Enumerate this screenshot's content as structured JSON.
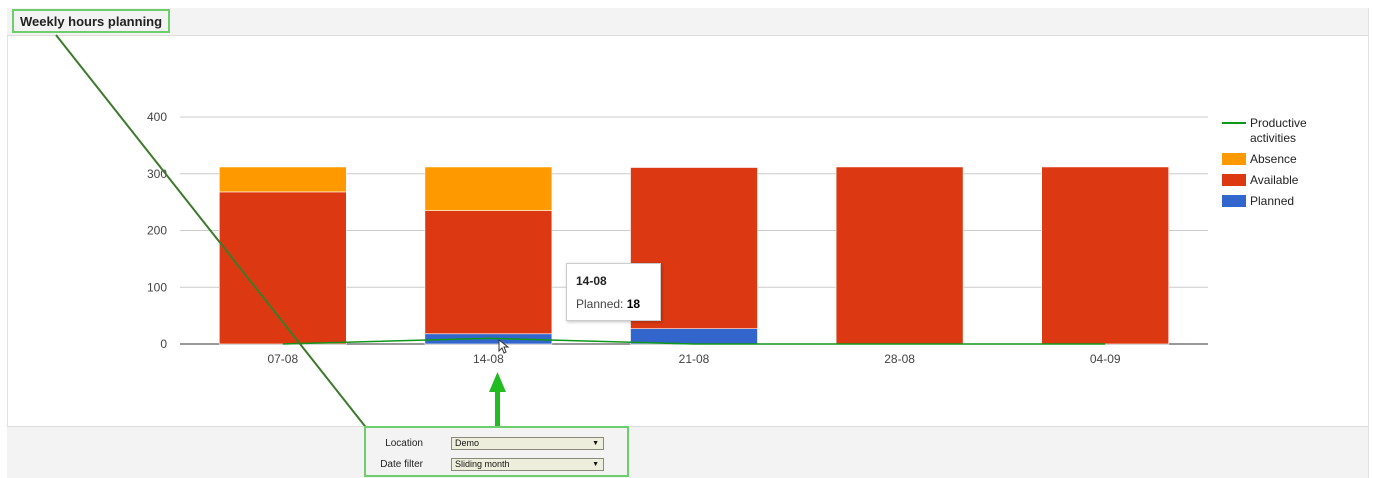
{
  "panel": {
    "title": "Weekly hours planning"
  },
  "chart_data": {
    "type": "bar",
    "stacked": true,
    "categories": [
      "07-08",
      "14-08",
      "21-08",
      "28-08",
      "04-09"
    ],
    "series": [
      {
        "name": "Planned",
        "kind": "bar",
        "color": "#3366cc",
        "values": [
          0,
          18,
          27,
          0,
          0
        ]
      },
      {
        "name": "Available",
        "kind": "bar",
        "color": "#dc3912",
        "values": [
          268,
          217,
          284,
          312,
          312
        ]
      },
      {
        "name": "Absence",
        "kind": "bar",
        "color": "#ff9900",
        "values": [
          44,
          77,
          0,
          0,
          0
        ]
      },
      {
        "name": "Productive activities",
        "kind": "line",
        "color": "#109618",
        "values": [
          0,
          10,
          0,
          0,
          0
        ]
      }
    ],
    "yticks": [
      0,
      100,
      200,
      300,
      400
    ],
    "ylim": [
      0,
      400
    ],
    "grid": true,
    "legend_position": "right"
  },
  "legend": {
    "items": [
      {
        "label": "Productive\nactivities",
        "line1": "Productive",
        "line2": "activities",
        "color": "#109618",
        "shape": "line"
      },
      {
        "label": "Absence",
        "color": "#ff9900",
        "shape": "box"
      },
      {
        "label": "Available",
        "color": "#dc3912",
        "shape": "box"
      },
      {
        "label": "Planned",
        "color": "#3366cc",
        "shape": "box"
      }
    ]
  },
  "tooltip": {
    "title": "14-08",
    "label": "Planned:",
    "value": "18"
  },
  "filters": {
    "location_label": "Location",
    "location_value": "Demo",
    "date_label": "Date filter",
    "date_value": "Sliding month",
    "dropdown_icon": "▼"
  },
  "annotation": {
    "color": "#6ccf6c",
    "line_color": "#3d7a2a"
  }
}
